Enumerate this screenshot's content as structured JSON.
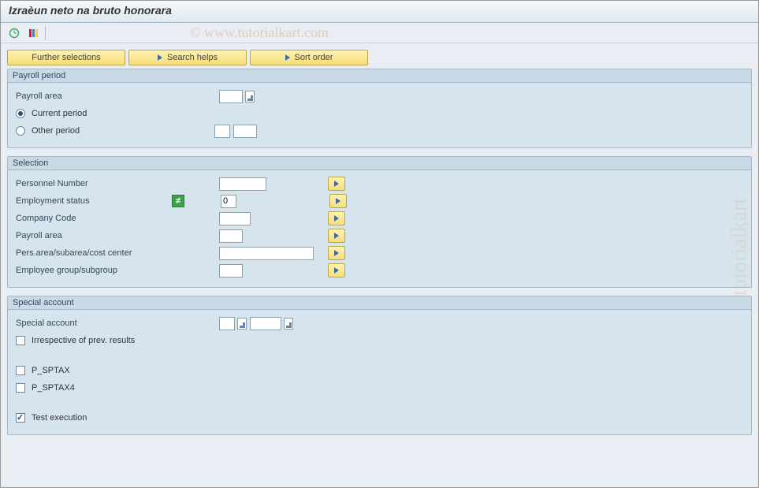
{
  "title": "Izraèun neto na bruto honorara",
  "watermark": "© www.tutorialkart.com",
  "watermark_side": "tutorialkart",
  "actions": {
    "further_selections": "Further selections",
    "search_helps": "Search helps",
    "sort_order": "Sort order"
  },
  "group_payroll_period": {
    "title": "Payroll period",
    "payroll_area_label": "Payroll area",
    "current_period_label": "Current period",
    "other_period_label": "Other period",
    "current_selected": true
  },
  "group_selection": {
    "title": "Selection",
    "rows": {
      "personnel_number": "Personnel Number",
      "employment_status": "Employment status",
      "employment_status_value": "0",
      "company_code": "Company Code",
      "payroll_area": "Payroll area",
      "pers_area": "Pers.area/subarea/cost center",
      "emp_group": "Employee group/subgroup"
    }
  },
  "group_special": {
    "title": "Special account",
    "special_account_label": "Special account",
    "irrespective_label": "Irrespective of prev. results",
    "p_sptax_label": "P_SPTAX",
    "p_sptax4_label": "P_SPTAX4",
    "test_exec_label": "Test execution",
    "test_exec_checked": true
  }
}
